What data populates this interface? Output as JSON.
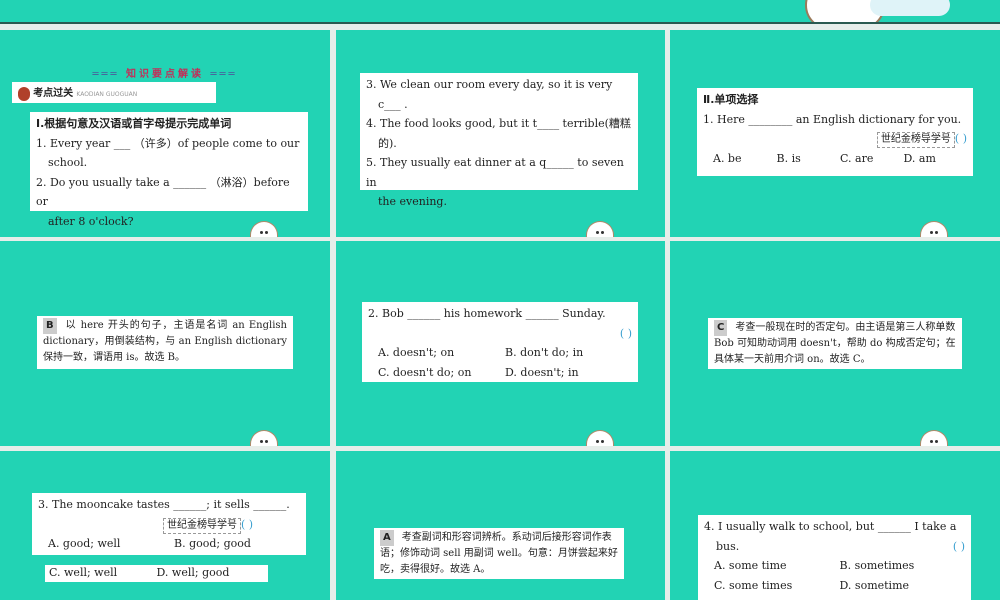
{
  "header": {
    "section_title": "知识要点解读",
    "banner_cn": "考点过关",
    "banner_en": "KAODIAN GUOGUAN"
  },
  "part1": {
    "title": "Ⅰ.根据句意及汉语或首字母提示完成单词",
    "q1": "1. Every year ___ （许多）of people come to our",
    "q1b": "school.",
    "q2": "2. Do you usually take a ______ （淋浴）before or",
    "q2b": "after 8 o'clock?",
    "q3": "3. We clean our room every day, so it is very",
    "q3b": "c___ .",
    "q4": "4. The food looks good, but it t____ terrible(糟糕",
    "q4b": "的).",
    "q5": "5. They usually eat dinner at a q_____ to seven in",
    "q5b": "the evening."
  },
  "part2": {
    "title": "Ⅱ.单项选择",
    "q1": "1. Here ________ an English dictionary for you.",
    "tag": "世纪金榜导学号",
    "paren": "(        )",
    "q1_opts": [
      "A. be",
      "B. is",
      "C. are",
      "D. am"
    ],
    "a1_letter": "B",
    "a1": "以 here 开头的句子，主语是名词 an English dictionary，用倒装结构，与 an English dictionary 保持一致，谓语用 is。故选 B。",
    "q2": "2. Bob ______ his homework ______ Sunday.",
    "q2_opts": [
      "A. doesn't; on",
      "B. don't do; in",
      "C. doesn't do; on",
      "D. doesn't; in"
    ],
    "a2_letter": "C",
    "a2": "考查一般现在时的否定句。由主语是第三人称单数 Bob 可知助动词用 doesn't，帮助 do 构成否定句；在具体某一天前用介词 on。故选 C。",
    "q3": "3. The mooncake tastes ______; it sells ______.",
    "q3_opts": [
      "A. good; well",
      "B. good; good",
      "C. well; well",
      "D. well; good"
    ],
    "a3_letter": "A",
    "a3": "考查副词和形容词辨析。系动词后接形容词作表语；修饰动词 sell 用副词 well。句意：月饼尝起来好吃，卖得很好。故选 A。",
    "q4": "4. I usually walk to school, but ______ I take a",
    "q4b": "bus.",
    "q4_opts": [
      "A. some time",
      "B. sometimes",
      "C. some times",
      "D. sometime"
    ]
  },
  "colors": {
    "teal": "#22d3b4",
    "bg": "#e6eeea"
  }
}
